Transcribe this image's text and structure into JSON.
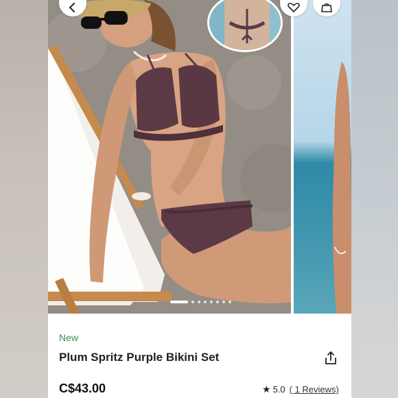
{
  "product": {
    "badge": "New",
    "title": "Plum Spritz Purple Bikini Set",
    "price": "C$43.00",
    "rating": "5.0",
    "reviews_link": "( 1 Reviews)"
  },
  "gallery": {
    "total_images": 8,
    "active_index": 0
  },
  "icons": {
    "back": "chevron-left-icon",
    "favorite": "heart-icon",
    "bag": "shopping-bag-icon",
    "share": "share-icon",
    "rating": "star-icon"
  },
  "colors": {
    "new_badge": "#3b8a4b",
    "bikini": "#5c3a45",
    "text": "#222222"
  }
}
